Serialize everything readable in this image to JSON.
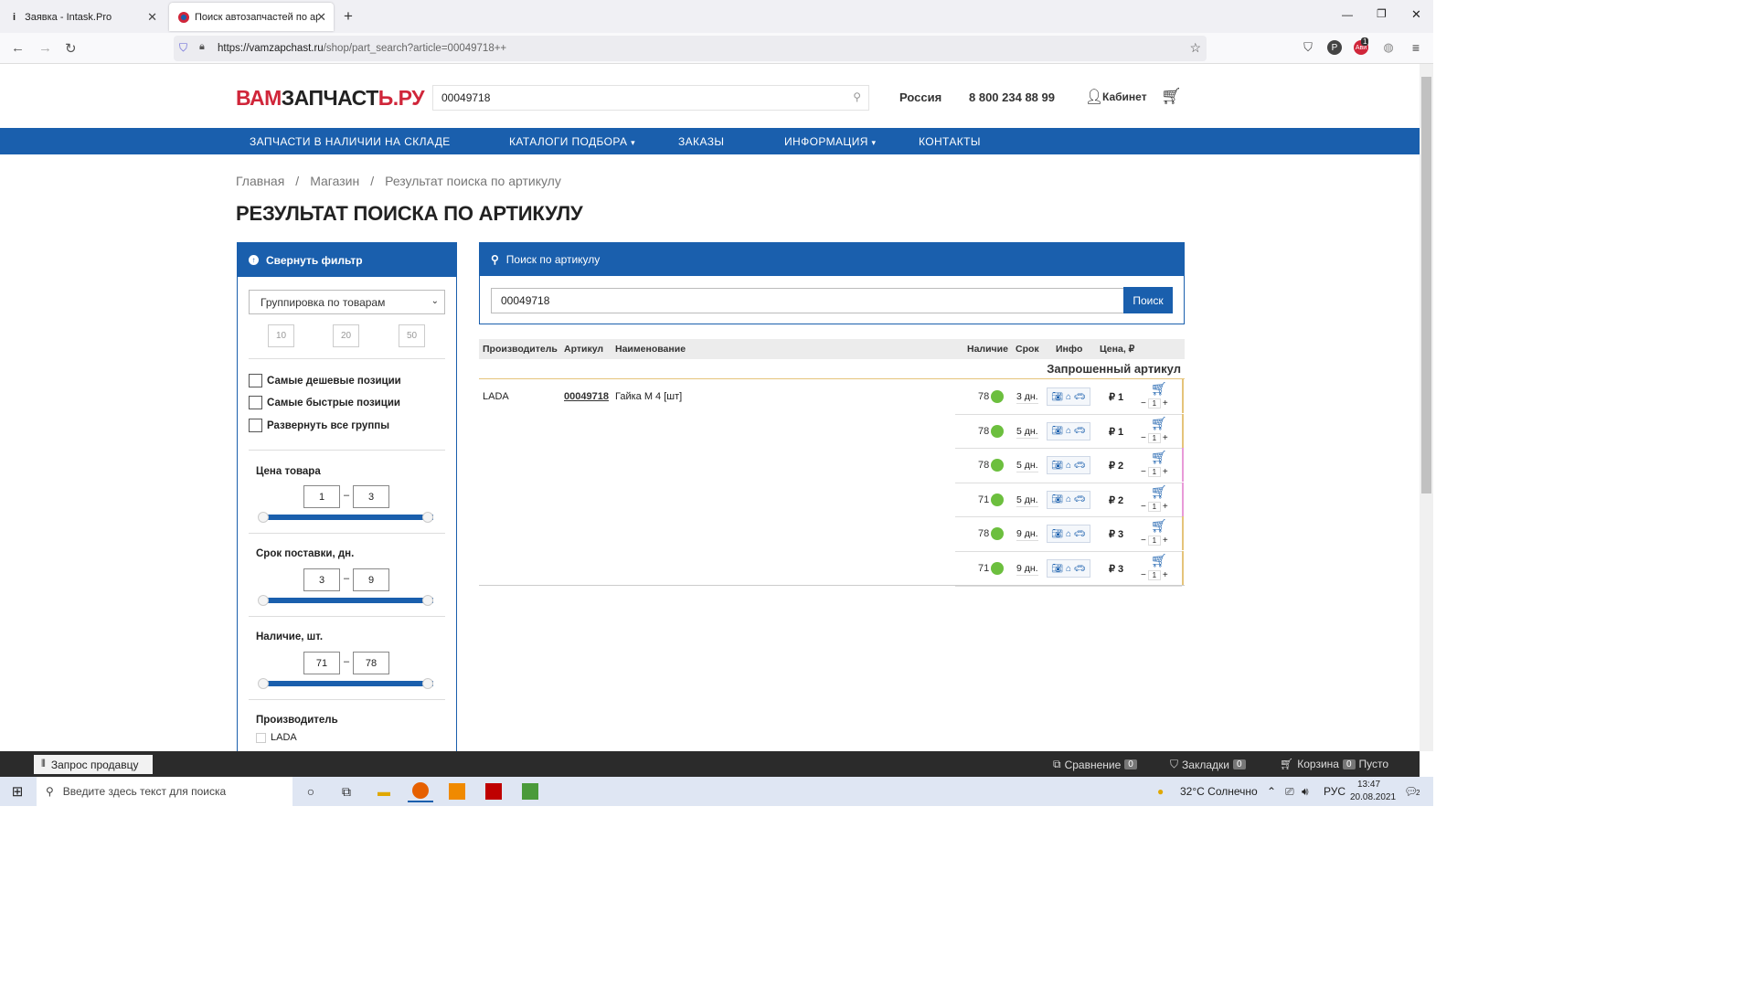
{
  "browser": {
    "tabs": [
      {
        "icon": "info-icon",
        "title": "Заявка - Intask.Pro"
      },
      {
        "icon": "site-favicon-icon",
        "title": "Поиск автозапчастей по артик"
      }
    ],
    "url_host": "https://vamzapchast.ru",
    "url_path": "/shop/part_search?article=00049718++",
    "badge_count": "1"
  },
  "header": {
    "logo_red": "ВАМ",
    "logo_dark": "ЗАПЧАСТ",
    "logo_red2": "Ь.РУ",
    "search_value": "00049718",
    "region": "Россия",
    "phone": "8 800 234 88 99",
    "cabinet": "Кабинет"
  },
  "nav": {
    "items": [
      "ЗАПЧАСТИ В НАЛИЧИИ НА СКЛАДЕ",
      "КАТАЛОГИ ПОДБОРА",
      "ЗАКАЗЫ",
      "ИНФОРМАЦИЯ",
      "КОНТАКТЫ"
    ]
  },
  "breadcrumb": [
    "Главная",
    "Магазин",
    "Результат поиска по артикулу"
  ],
  "page_title": "РЕЗУЛЬТАТ ПОИСКА ПО АРТИКУЛУ",
  "filter": {
    "collapse_label": "Свернуть фильтр",
    "grouping": "Группировка по товарам",
    "page_sizes": [
      "10",
      "20",
      "50"
    ],
    "checkboxes": [
      "Самые дешевые позиции",
      "Самые быстрые позиции",
      "Развернуть все группы"
    ],
    "price": {
      "label": "Цена товара",
      "min": "1",
      "max": "3"
    },
    "delivery": {
      "label": "Срок поставки, дн.",
      "min": "3",
      "max": "9"
    },
    "stock": {
      "label": "Наличие, шт.",
      "min": "71",
      "max": "78"
    },
    "manufacturer": {
      "label": "Производитель",
      "option": "LADA"
    }
  },
  "article_search": {
    "title": "Поиск по артикулу",
    "value": "00049718",
    "button": "Поиск"
  },
  "results": {
    "columns": [
      "Производитель",
      "Артикул",
      "Наименование",
      "Наличие",
      "Срок",
      "Инфо",
      "Цена, ₽"
    ],
    "requested_label": "Запрошенный артикул",
    "manufacturer": "LADA",
    "article": "00049718",
    "name": "Гайка М 4 [шт]",
    "rows": [
      {
        "stock": "78",
        "term": "3 дн.",
        "price": "₽ 1",
        "qty": "1"
      },
      {
        "stock": "78",
        "term": "5 дн.",
        "price": "₽ 1",
        "qty": "1"
      },
      {
        "stock": "78",
        "term": "5 дн.",
        "price": "₽ 2",
        "qty": "1"
      },
      {
        "stock": "71",
        "term": "5 дн.",
        "price": "₽ 2",
        "qty": "1"
      },
      {
        "stock": "78",
        "term": "9 дн.",
        "price": "₽ 3",
        "qty": "1"
      },
      {
        "stock": "71",
        "term": "9 дн.",
        "price": "₽ 3",
        "qty": "1"
      }
    ]
  },
  "bottom_bar": {
    "ask_seller": "Запрос продавцу",
    "compare": "Сравнение",
    "compare_count": "0",
    "bookmarks": "Закладки",
    "bookmarks_count": "0",
    "cart": "Корзина",
    "cart_count": "0",
    "cart_state": "Пусто"
  },
  "taskbar": {
    "search_placeholder": "Введите здесь текст для поиска",
    "weather": "32°C  Солнечно",
    "lang": "РУС",
    "time": "13:47",
    "date": "20.08.2021",
    "notifications": "2"
  }
}
